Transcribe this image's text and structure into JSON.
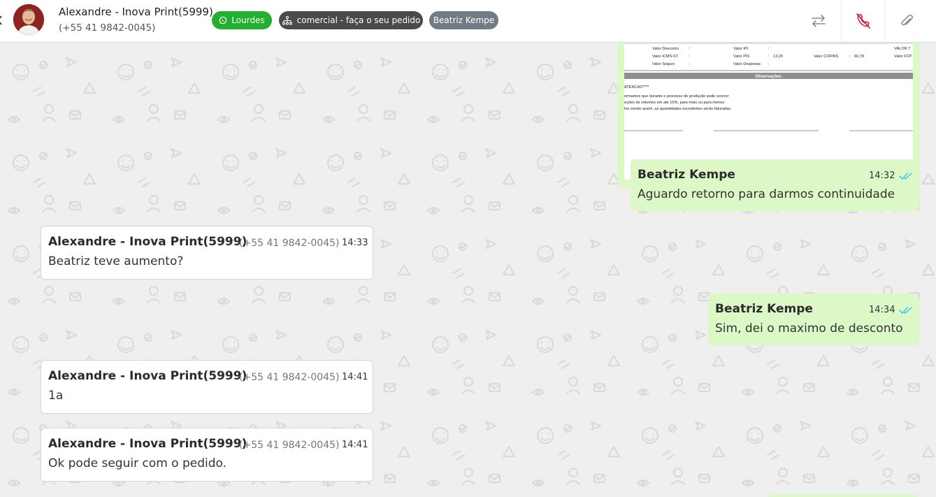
{
  "header": {
    "contact_name": "Alexandre - Inova Print(5999)",
    "contact_phone": "(+55 41 9842-0045)",
    "tags": {
      "channel": "Lourdes",
      "queue": "comercial - faça o seu pedido",
      "user": "Beatriz Kempe"
    },
    "actions": {
      "transfer_icon": "transfer-icon",
      "hangup_icon": "phone-hangup-icon",
      "attach_icon": "paperclip-icon"
    }
  },
  "document": {
    "row1": {
      "a_label": "Valor Desconto",
      "a_sep": ":",
      "b_label": "Valor IPI",
      "b_sep": ":",
      "c_label": "VALOR T"
    },
    "row2": {
      "a_label": "Valor ICMS-ST",
      "a_sep": ":",
      "b_label": "Valor PIS",
      "b_sep": ":",
      "b_value": "13,20",
      "c_label": "Valor COFINS",
      "c_sep": ":",
      "c_value": "60,78",
      "d_label": "Valor FCP"
    },
    "row3": {
      "a_label": "Valor Seguro",
      "a_sep": ":",
      "b_label": "Valor Despesas",
      "b_sep": ":"
    },
    "section_title": "Observações",
    "notes": [
      "ATENCAO****",
      "ormamos que durante o processo de produção pode ocorrer",
      "eções de volumes em até 10%, para mais ou para menos",
      "tos sendo assim, as quantidades excedentes serão faturadas."
    ]
  },
  "messages": [
    {
      "sender": "Beatriz Kempe",
      "time": "14:32",
      "text": "Aguardo retorno para darmos continuidade",
      "status": "read"
    },
    {
      "sender": "Alexandre - Inova Print(5999)",
      "phone": "(+55 41 9842-0045)",
      "time": "14:33",
      "text": "Beatriz teve aumento?"
    },
    {
      "sender": "Beatriz Kempe",
      "time": "14:34",
      "text": "Sim, dei o maximo de desconto",
      "status": "read"
    },
    {
      "sender": "Alexandre - Inova Print(5999)",
      "phone": "(+55 41 9842-0045)",
      "time": "14:41",
      "text": "1a"
    },
    {
      "sender": "Alexandre - Inova Print(5999)",
      "phone": "(+55 41 9842-0045)",
      "time": "14:41",
      "text": "Ok pode seguir com o pedido."
    }
  ],
  "colors": {
    "outgoing_bubble": "#dcf8c6",
    "incoming_bubble": "#ffffff",
    "channel_tag": "#22b02e",
    "queue_tag": "#4a4a4a",
    "user_tag": "#707b86",
    "read_ticks": "#4fc3f7",
    "hangup_icon": "#d0243e"
  }
}
